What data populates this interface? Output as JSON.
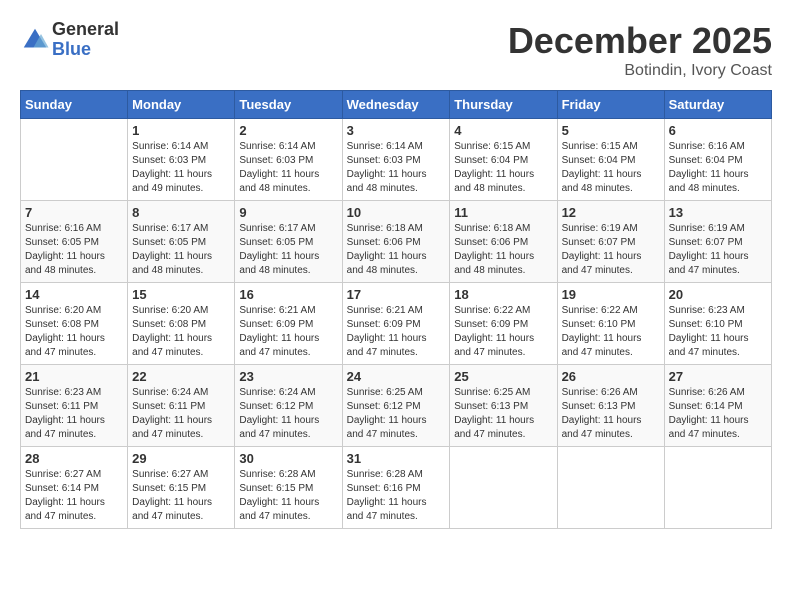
{
  "logo": {
    "general": "General",
    "blue": "Blue"
  },
  "title": "December 2025",
  "location": "Botindin, Ivory Coast",
  "days_header": [
    "Sunday",
    "Monday",
    "Tuesday",
    "Wednesday",
    "Thursday",
    "Friday",
    "Saturday"
  ],
  "weeks": [
    [
      {
        "num": "",
        "info": ""
      },
      {
        "num": "1",
        "info": "Sunrise: 6:14 AM\nSunset: 6:03 PM\nDaylight: 11 hours\nand 49 minutes."
      },
      {
        "num": "2",
        "info": "Sunrise: 6:14 AM\nSunset: 6:03 PM\nDaylight: 11 hours\nand 48 minutes."
      },
      {
        "num": "3",
        "info": "Sunrise: 6:14 AM\nSunset: 6:03 PM\nDaylight: 11 hours\nand 48 minutes."
      },
      {
        "num": "4",
        "info": "Sunrise: 6:15 AM\nSunset: 6:04 PM\nDaylight: 11 hours\nand 48 minutes."
      },
      {
        "num": "5",
        "info": "Sunrise: 6:15 AM\nSunset: 6:04 PM\nDaylight: 11 hours\nand 48 minutes."
      },
      {
        "num": "6",
        "info": "Sunrise: 6:16 AM\nSunset: 6:04 PM\nDaylight: 11 hours\nand 48 minutes."
      }
    ],
    [
      {
        "num": "7",
        "info": "Sunrise: 6:16 AM\nSunset: 6:05 PM\nDaylight: 11 hours\nand 48 minutes."
      },
      {
        "num": "8",
        "info": "Sunrise: 6:17 AM\nSunset: 6:05 PM\nDaylight: 11 hours\nand 48 minutes."
      },
      {
        "num": "9",
        "info": "Sunrise: 6:17 AM\nSunset: 6:05 PM\nDaylight: 11 hours\nand 48 minutes."
      },
      {
        "num": "10",
        "info": "Sunrise: 6:18 AM\nSunset: 6:06 PM\nDaylight: 11 hours\nand 48 minutes."
      },
      {
        "num": "11",
        "info": "Sunrise: 6:18 AM\nSunset: 6:06 PM\nDaylight: 11 hours\nand 48 minutes."
      },
      {
        "num": "12",
        "info": "Sunrise: 6:19 AM\nSunset: 6:07 PM\nDaylight: 11 hours\nand 47 minutes."
      },
      {
        "num": "13",
        "info": "Sunrise: 6:19 AM\nSunset: 6:07 PM\nDaylight: 11 hours\nand 47 minutes."
      }
    ],
    [
      {
        "num": "14",
        "info": "Sunrise: 6:20 AM\nSunset: 6:08 PM\nDaylight: 11 hours\nand 47 minutes."
      },
      {
        "num": "15",
        "info": "Sunrise: 6:20 AM\nSunset: 6:08 PM\nDaylight: 11 hours\nand 47 minutes."
      },
      {
        "num": "16",
        "info": "Sunrise: 6:21 AM\nSunset: 6:09 PM\nDaylight: 11 hours\nand 47 minutes."
      },
      {
        "num": "17",
        "info": "Sunrise: 6:21 AM\nSunset: 6:09 PM\nDaylight: 11 hours\nand 47 minutes."
      },
      {
        "num": "18",
        "info": "Sunrise: 6:22 AM\nSunset: 6:09 PM\nDaylight: 11 hours\nand 47 minutes."
      },
      {
        "num": "19",
        "info": "Sunrise: 6:22 AM\nSunset: 6:10 PM\nDaylight: 11 hours\nand 47 minutes."
      },
      {
        "num": "20",
        "info": "Sunrise: 6:23 AM\nSunset: 6:10 PM\nDaylight: 11 hours\nand 47 minutes."
      }
    ],
    [
      {
        "num": "21",
        "info": "Sunrise: 6:23 AM\nSunset: 6:11 PM\nDaylight: 11 hours\nand 47 minutes."
      },
      {
        "num": "22",
        "info": "Sunrise: 6:24 AM\nSunset: 6:11 PM\nDaylight: 11 hours\nand 47 minutes."
      },
      {
        "num": "23",
        "info": "Sunrise: 6:24 AM\nSunset: 6:12 PM\nDaylight: 11 hours\nand 47 minutes."
      },
      {
        "num": "24",
        "info": "Sunrise: 6:25 AM\nSunset: 6:12 PM\nDaylight: 11 hours\nand 47 minutes."
      },
      {
        "num": "25",
        "info": "Sunrise: 6:25 AM\nSunset: 6:13 PM\nDaylight: 11 hours\nand 47 minutes."
      },
      {
        "num": "26",
        "info": "Sunrise: 6:26 AM\nSunset: 6:13 PM\nDaylight: 11 hours\nand 47 minutes."
      },
      {
        "num": "27",
        "info": "Sunrise: 6:26 AM\nSunset: 6:14 PM\nDaylight: 11 hours\nand 47 minutes."
      }
    ],
    [
      {
        "num": "28",
        "info": "Sunrise: 6:27 AM\nSunset: 6:14 PM\nDaylight: 11 hours\nand 47 minutes."
      },
      {
        "num": "29",
        "info": "Sunrise: 6:27 AM\nSunset: 6:15 PM\nDaylight: 11 hours\nand 47 minutes."
      },
      {
        "num": "30",
        "info": "Sunrise: 6:28 AM\nSunset: 6:15 PM\nDaylight: 11 hours\nand 47 minutes."
      },
      {
        "num": "31",
        "info": "Sunrise: 6:28 AM\nSunset: 6:16 PM\nDaylight: 11 hours\nand 47 minutes."
      },
      {
        "num": "",
        "info": ""
      },
      {
        "num": "",
        "info": ""
      },
      {
        "num": "",
        "info": ""
      }
    ]
  ]
}
